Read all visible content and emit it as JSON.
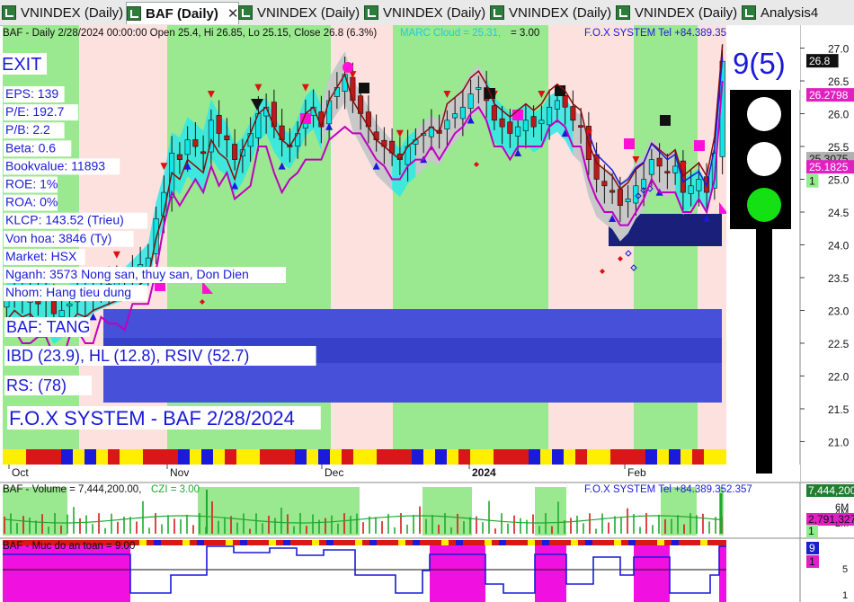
{
  "tabs": [
    {
      "label": "VNINDEX (Daily)",
      "active": false
    },
    {
      "label": "BAF (Daily)",
      "active": true
    },
    {
      "label": "VNINDEX (Daily)",
      "active": false
    },
    {
      "label": "VNINDEX (Daily)",
      "active": false
    },
    {
      "label": "VNINDEX (Daily)",
      "active": false
    },
    {
      "label": "VNINDEX (Daily)",
      "active": false
    },
    {
      "label": "Analysis4",
      "active": false
    }
  ],
  "tab_close": "✕",
  "price_header": {
    "text": "BAF - Daily 2/28/2024 00:00:00 Open 25.4, Hi 26.85, Lo 25.15, Close 26.8 (6.3%)",
    "marc": "MARC Cloud = 25.31,",
    "eq": "= 3.00",
    "contact": "F.O.X SYSTEM Tel +84.389.352.357"
  },
  "overlay": {
    "signal": "EXIT",
    "fundamentals": [
      "EPS: 139",
      "P/E: 192.7",
      "P/B: 2.2",
      "Beta: 0.6",
      "Bookvalue: 11893",
      "ROE: 1%",
      "ROA: 0%",
      "KLCP: 143.52 (Trieu)",
      "Von hoa: 3846 (Ty)",
      "Market: HSX",
      "Nganh: 3573 Nong san, thuy san, Don Dien",
      "Nhom: Hang tieu dung"
    ],
    "trend": "BAF: TANG",
    "ibd": "IBD (23.9), HL (12.8), RSIV (52.7)",
    "rs": "RS:  (78)",
    "banner": "F.O.X SYSTEM - BAF 2/28/2024",
    "count": "9(5)"
  },
  "colors": {
    "green_zone": "#9ae88f",
    "pink_zone": "#fde1de",
    "up_candle": "#11e6e6",
    "down_candle": "#c01818",
    "cloud": "#c8c8c8",
    "trail": "#c000c0",
    "navy": "#1a1f7a",
    "blue_band": "#4650d8"
  },
  "y_axis_ticks": [
    "27.0",
    "26.5",
    "26.0",
    "25.5",
    "25.0",
    "24.5",
    "24.0",
    "23.5",
    "23.0",
    "22.5",
    "22.0",
    "21.5",
    "21.0"
  ],
  "price_tags": [
    {
      "value": "26.8",
      "bg": "#111111",
      "fg": "#ffffff"
    },
    {
      "value": "26.2798",
      "bg": "#e020c0",
      "fg": "#ffffff"
    },
    {
      "value": "25.3075",
      "bg": "#b0b0b0",
      "fg": "#111111"
    },
    {
      "value": "25.1825",
      "bg": "#e020c0",
      "fg": "#ffffff"
    },
    {
      "value": "1",
      "bg": "#90ee90",
      "fg": "#111111"
    }
  ],
  "x_axis_labels": [
    {
      "label": "Oct",
      "bold": false
    },
    {
      "label": "Nov",
      "bold": false
    },
    {
      "label": "Dec",
      "bold": false
    },
    {
      "label": "2024",
      "bold": true
    },
    {
      "label": "Feb",
      "bold": false
    }
  ],
  "volume_header": {
    "text": "BAF - Volume = 7,444,200.00,",
    "czi": "CZI = 3.00",
    "contact": "F.O.X SYSTEM Tel +84.389.352.357"
  },
  "volume_axis": [
    "6M",
    "4M",
    "2M"
  ],
  "volume_tags": [
    {
      "value": "7,444,200",
      "bg": "#1f7f2f",
      "fg": "#ffffff"
    },
    {
      "value": "2,791,327",
      "bg": "#e020c0",
      "fg": "#111111"
    },
    {
      "value": "1",
      "bg": "#90ee90",
      "fg": "#111111"
    }
  ],
  "safety_header": {
    "text": "BAF - Muc do an toan = 9.00"
  },
  "safety_axis": [
    "5",
    "1"
  ],
  "safety_tags": [
    {
      "value": "9",
      "bg": "#1a1fd0",
      "fg": "#ffffff"
    },
    {
      "value": "1",
      "bg": "#e020c0",
      "fg": "#111111"
    }
  ],
  "chart_data": {
    "type": "candlestick",
    "title": "BAF - Daily 2/28/2024",
    "ylim": [
      20.65,
      27.35
    ],
    "last_bar": {
      "date": "2/28/2024",
      "open": 25.4,
      "high": 26.85,
      "low": 25.15,
      "close": 26.8,
      "change_pct": 6.3
    },
    "indicators": {
      "marc_cloud": 25.31,
      "trail_stop": 26.2798,
      "cloud_mid": 25.3075,
      "cloud_low": 25.1825,
      "volume": 7444200,
      "volume_ma": 2791327,
      "safety_level": 9
    },
    "closes": [
      23.15,
      23.3,
      23.2,
      23.25,
      23.1,
      23.2,
      22.95,
      23.0,
      23.1,
      23.25,
      23.2,
      23.3,
      23.35,
      23.4,
      23.45,
      23.5,
      23.6,
      23.7,
      23.8,
      24.4,
      24.8,
      25.4,
      25.3,
      25.6,
      25.5,
      25.4,
      25.9,
      25.7,
      25.6,
      25.3,
      25.45,
      25.7,
      26.0,
      26.1,
      25.8,
      25.6,
      25.5,
      25.7,
      26.0,
      26.1,
      25.8,
      26.2,
      26.4,
      26.6,
      26.2,
      26.0,
      25.8,
      25.6,
      25.5,
      25.4,
      25.3,
      25.5,
      25.6,
      25.7,
      25.8,
      25.7,
      25.9,
      26.0,
      26.1,
      26.3,
      26.4,
      26.2,
      25.9,
      25.8,
      25.7,
      25.8,
      25.9,
      25.8,
      25.9,
      26.1,
      26.2,
      26.1,
      25.9,
      25.8,
      25.3,
      25.0,
      24.9,
      24.8,
      24.6,
      24.7,
      24.9,
      25.0,
      25.3,
      25.2,
      25.1,
      25.2,
      24.8,
      24.9,
      25.0,
      24.8,
      25.4,
      26.8
    ]
  }
}
